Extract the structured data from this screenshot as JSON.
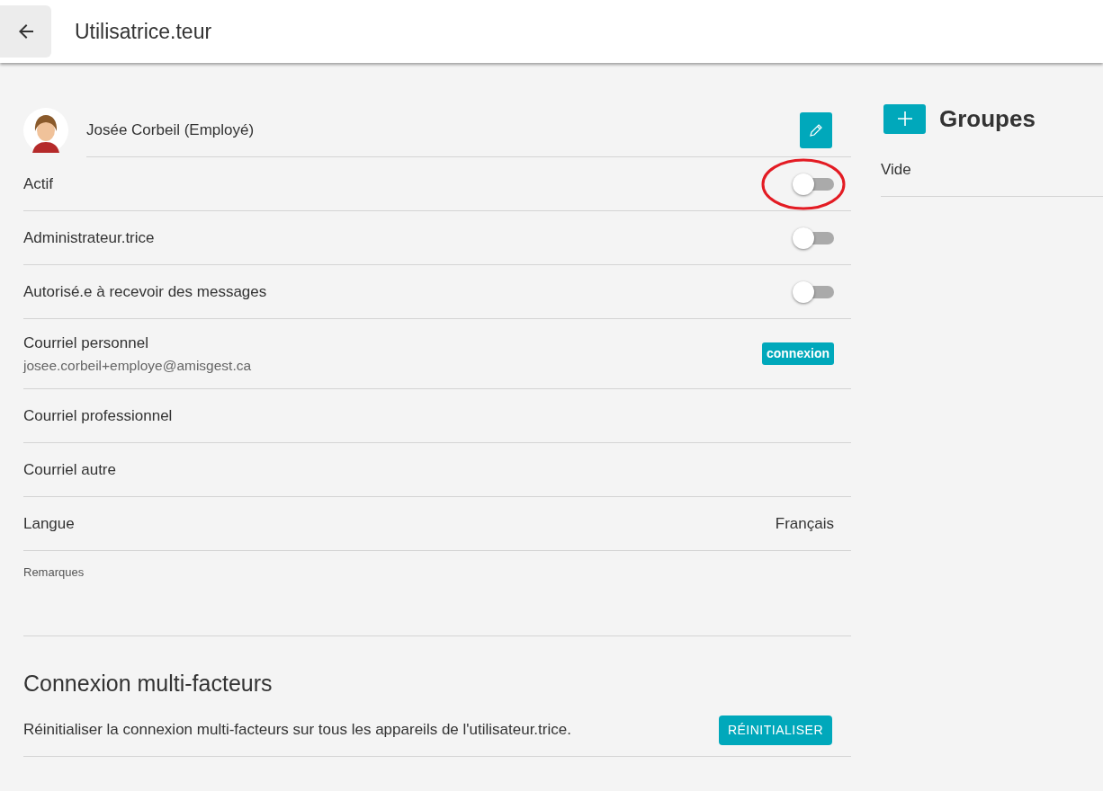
{
  "header": {
    "title": "Utilisatrice.teur"
  },
  "user": {
    "name": "Josée Corbeil (Employé)"
  },
  "fields": [
    {
      "kind": "toggle",
      "label": "Actif",
      "on": false,
      "highlighted": true
    },
    {
      "kind": "toggle",
      "label": "Administrateur.trice",
      "on": false,
      "highlighted": false
    },
    {
      "kind": "toggle",
      "label": "Autorisé.e à recevoir des messages",
      "on": false,
      "highlighted": false
    },
    {
      "kind": "email",
      "label": "Courriel personnel",
      "value": "josee.corbeil+employe@amisgest.ca",
      "badge": "connexion"
    },
    {
      "kind": "text",
      "label": "Courriel professionnel"
    },
    {
      "kind": "text",
      "label": "Courriel autre"
    },
    {
      "kind": "text",
      "label": "Langue",
      "value": "Français"
    }
  ],
  "remarks": {
    "label": "Remarques"
  },
  "mfa": {
    "title": "Connexion multi-facteurs",
    "text": "Réinitialiser la connexion multi-facteurs sur tous les appareils de l'utilisateur.trice.",
    "button": "RÉINITIALISER"
  },
  "groups": {
    "title": "Groupes",
    "empty": "Vide"
  }
}
